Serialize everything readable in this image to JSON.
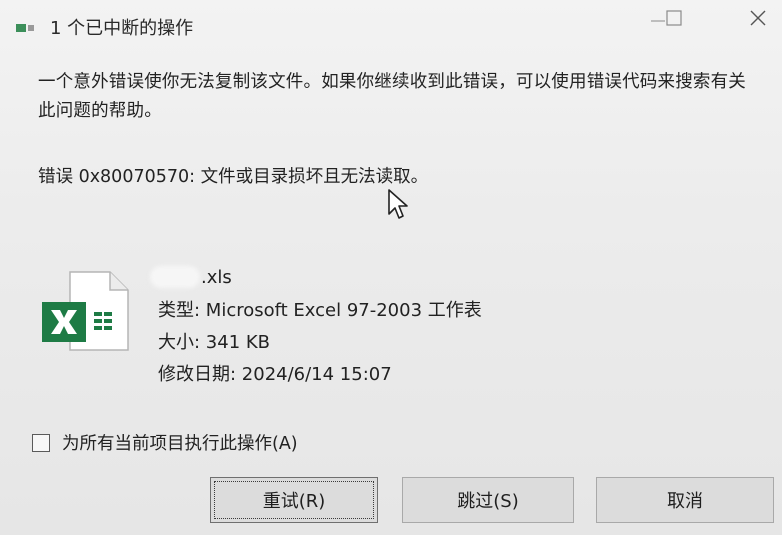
{
  "window": {
    "title": "1 个已中断的操作",
    "minimize_glyph": "—",
    "maximize_glyph": "☐",
    "close_glyph": "✕"
  },
  "message": {
    "body": "一个意外错误使你无法复制该文件。如果你继续收到此错误，可以使用错误代码来搜索有关此问题的帮助。",
    "error_line": "错误 0x80070570: 文件或目录损坏且无法读取。"
  },
  "file": {
    "name_suffix": ".xls",
    "icon": "excel-file-icon",
    "type_line": "类型: Microsoft Excel 97-2003 工作表",
    "size_line": "大小: 341 KB",
    "date_line": "修改日期: 2024/6/14 15:07"
  },
  "checkbox": {
    "label": "为所有当前项目执行此操作(A)",
    "checked": false
  },
  "buttons": {
    "retry": "重试(R)",
    "skip": "跳过(S)",
    "cancel": "取消"
  },
  "colors": {
    "excel_green": "#1e7b45",
    "background": "#ececec",
    "button_face": "#dcdcdc"
  }
}
